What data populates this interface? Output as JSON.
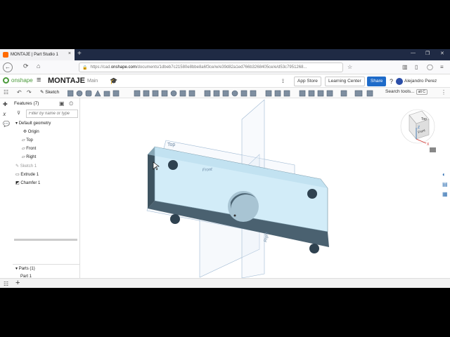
{
  "browser": {
    "tab_title": "MONTAJE | Part Studio 1",
    "tab_close": "×",
    "new_tab": "+",
    "url_prefix": "https://cad.",
    "url_domain": "onshape.com",
    "url_rest": "/documents/1dbeb7c21580e8bbe8a6f3ce/w/e39d82a1ed766b3268405ce/e/d53c7951268..."
  },
  "header": {
    "logo_text": "onshape",
    "doc_title": "MONTAJE",
    "branch": "Main",
    "app_store": "App Store",
    "learning_center": "Learning Center",
    "share": "Share",
    "help": "?",
    "user": "Alejandro Perez"
  },
  "toolbar": {
    "sketch": "Sketch",
    "search_tools": "Search tools...",
    "search_kbd": "alt C"
  },
  "features": {
    "heading": "Features (7)",
    "filter_placeholder": "Filter by name or type",
    "items": [
      {
        "label": "Default geometry"
      },
      {
        "label": "Origin"
      },
      {
        "label": "Top"
      },
      {
        "label": "Front"
      },
      {
        "label": "Right"
      },
      {
        "label": "Sketch 1"
      },
      {
        "label": "Extrude 1"
      },
      {
        "label": "Chamfer 1"
      }
    ],
    "parts_heading": "Parts (1)",
    "parts": [
      {
        "label": "Part 1"
      }
    ]
  },
  "viewport": {
    "plane_top": "Top",
    "plane_front": "Front",
    "plane_right": "Right",
    "cube_top": "Top",
    "cube_front": "Front",
    "axis_x": "X",
    "axis_z": "Z"
  },
  "colors": {
    "part_face": "#d2ecf8",
    "part_side": "#4a6170",
    "plane": "#9fb9d3",
    "accent": "#1e6bc9"
  }
}
